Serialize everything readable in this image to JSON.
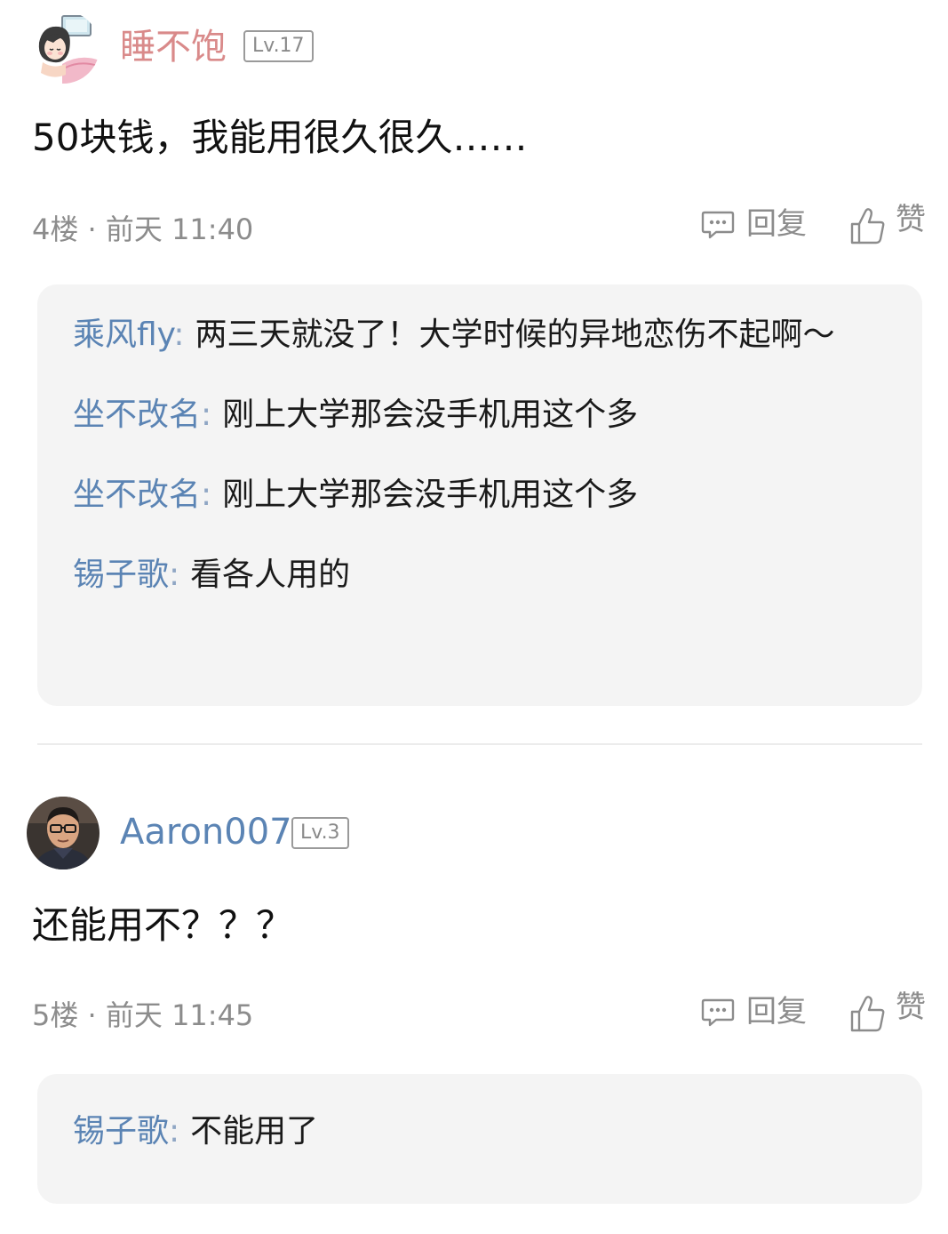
{
  "posts": [
    {
      "username": "睡不饱",
      "username_color": "#d98a8a",
      "level": "Lv.17",
      "content": "50块钱，我能用很久很久……",
      "floor": "4楼",
      "sep": "·",
      "time": "前天 11:40",
      "reply_label": "回复",
      "like_label": "赞",
      "avatar_icon": "cartoon-girl-avatar",
      "replies": [
        {
          "user": "乘风fly",
          "colon": ":",
          "text": "两三天就没了！大学时候的异地恋伤不起啊～"
        },
        {
          "user": "坐不改名",
          "colon": ":",
          "text": "刚上大学那会没手机用这个多"
        },
        {
          "user": "坐不改名",
          "colon": ":",
          "text": "刚上大学那会没手机用这个多"
        },
        {
          "user": "锡子歌",
          "colon": ":",
          "text": "看各人用的"
        }
      ]
    },
    {
      "username": "Aaron007",
      "username_color": "#5b84b4",
      "level": "Lv.3",
      "content": "还能用不？？？",
      "floor": "5楼",
      "sep": "·",
      "time": "前天 11:45",
      "reply_label": "回复",
      "like_label": "赞",
      "avatar_icon": "man-with-glasses-photo-avatar",
      "replies": [
        {
          "user": "锡子歌",
          "colon": ":",
          "text": "不能用了"
        }
      ]
    }
  ],
  "colors": {
    "reply_user": "#5b84b4",
    "meta_gray": "#8c8c8c",
    "reply_bg": "#f4f4f4"
  }
}
